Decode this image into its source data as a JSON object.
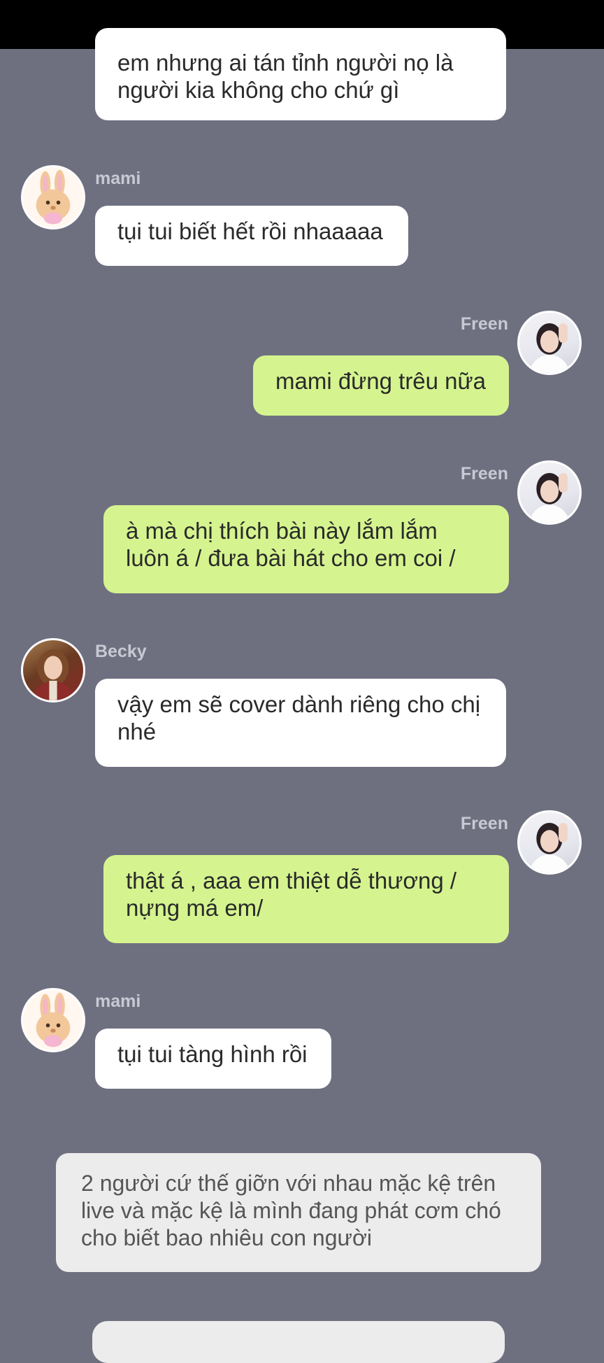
{
  "messages": [
    {
      "name": "",
      "text": "em nhưng ai tán tỉnh người nọ là người kia không cho chứ gì"
    },
    {
      "name": "mami",
      "text": "tụi tui biết hết rồi nhaaaaa"
    },
    {
      "name": "Freen",
      "text": "mami đừng trêu nữa"
    },
    {
      "name": "Freen",
      "text": "à mà chị thích bài này lắm lắm luôn á / đưa bài hát cho em coi /"
    },
    {
      "name": "Becky",
      "text": "vậy em sẽ cover dành riêng cho chị nhé"
    },
    {
      "name": "Freen",
      "text": "thật á , aaa em thiệt dễ thương / nựng má em/"
    },
    {
      "name": "mami",
      "text": "tụi tui tàng hình rồi"
    }
  ],
  "narration": "2 người cứ thế giỡn với nhau mặc kệ trên live và mặc kệ là mình đang phát cơm chó cho biết bao nhiêu con người",
  "colors": {
    "background": "#6e7080",
    "left_bubble": "#ffffff",
    "right_bubble": "#d5f48f",
    "narration_bubble": "#ececec",
    "name_text": "#c8c9d2"
  }
}
